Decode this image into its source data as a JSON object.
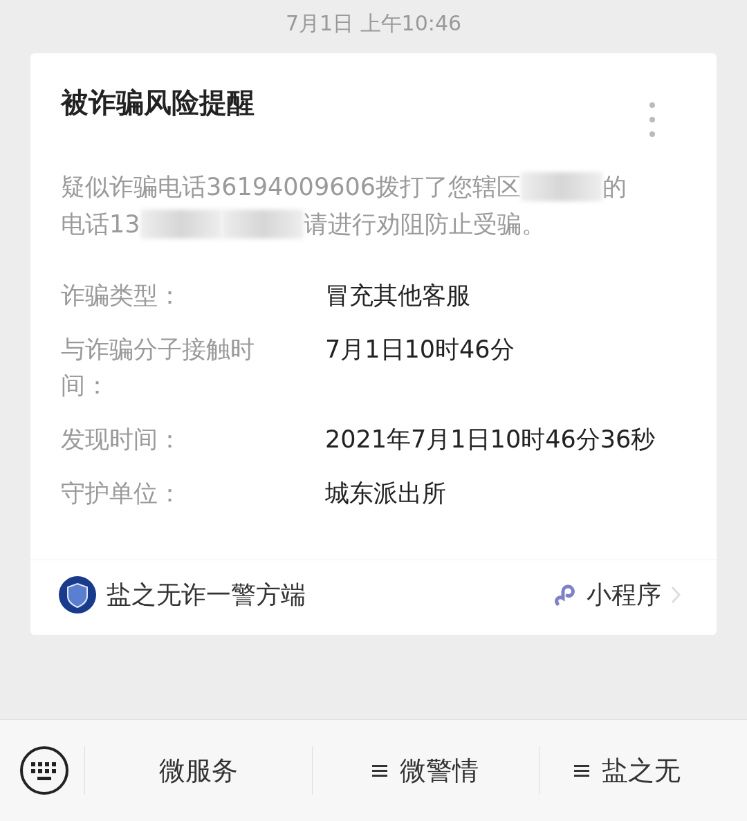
{
  "timestamp": "7月1日 上午10:46",
  "card": {
    "title": "被诈骗风险提醒",
    "message_lines": [
      [
        {
          "kind": "text",
          "text": "疑似诈骗电话36194009606拨打了您辖区"
        },
        {
          "kind": "redacted"
        },
        {
          "kind": "text",
          "text": "的"
        }
      ],
      [
        {
          "kind": "text",
          "text": "电话13"
        },
        {
          "kind": "redacted"
        },
        {
          "kind": "redacted"
        },
        {
          "kind": "text",
          "text": "请进行劝阻防止受骗。"
        }
      ]
    ],
    "fields": [
      {
        "label": "诈骗类型：",
        "value": "冒充其他客服"
      },
      {
        "label": "与诈骗分子接触时间：",
        "value": "7月1日10时46分"
      },
      {
        "label": "发现时间：",
        "value": "2021年7月1日10时46分36秒"
      },
      {
        "label": "守护单位：",
        "value": "城东派出所"
      }
    ],
    "source": "盐之无诈一警方端",
    "source_type": "小程序"
  },
  "menu": [
    {
      "label": "微服务",
      "has_submenu": false
    },
    {
      "label": "微警情",
      "has_submenu": true
    },
    {
      "label": "盐之无",
      "has_submenu": true
    }
  ]
}
